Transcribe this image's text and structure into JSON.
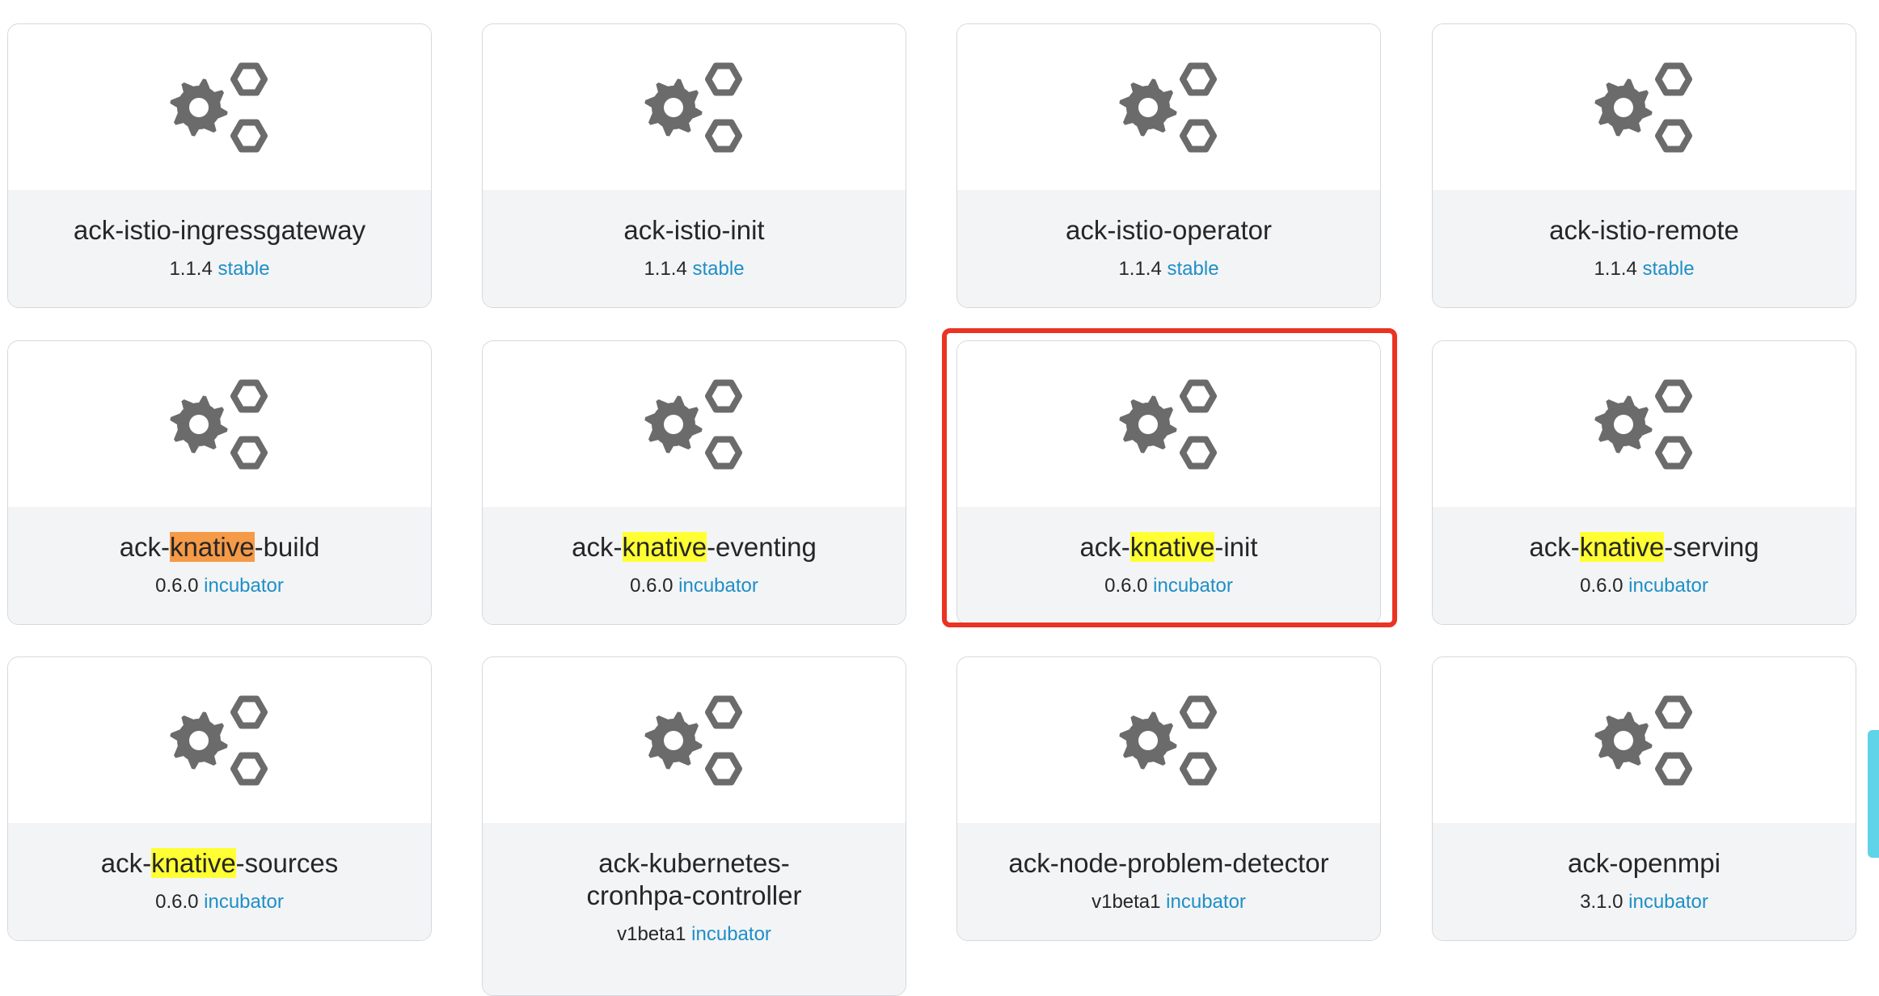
{
  "colors": {
    "highlight": "#ffff33",
    "highlight_active": "#f59a47",
    "channel_link": "#1e8fc6",
    "selection_border": "#ea3323",
    "icon_gray": "#6b6b6b"
  },
  "charts": [
    {
      "icon": "gears-icon",
      "name_prefix": "ack-istio-ingressgateway",
      "name_highlight": "",
      "name_suffix": "",
      "version": "1.1.4",
      "channel": "stable"
    },
    {
      "icon": "gears-icon",
      "name_prefix": "ack-istio-init",
      "name_highlight": "",
      "name_suffix": "",
      "version": "1.1.4",
      "channel": "stable"
    },
    {
      "icon": "gears-icon",
      "name_prefix": "ack-istio-operator",
      "name_highlight": "",
      "name_suffix": "",
      "version": "1.1.4",
      "channel": "stable"
    },
    {
      "icon": "gears-icon",
      "name_prefix": "ack-istio-remote",
      "name_highlight": "",
      "name_suffix": "",
      "version": "1.1.4",
      "channel": "stable"
    },
    {
      "icon": "gears-icon",
      "name_prefix": "ack-",
      "name_highlight": "knative",
      "name_suffix": "-build",
      "version": "0.6.0",
      "channel": "incubator",
      "active_match": true
    },
    {
      "icon": "gears-icon",
      "name_prefix": "ack-",
      "name_highlight": "knative",
      "name_suffix": "-eventing",
      "version": "0.6.0",
      "channel": "incubator"
    },
    {
      "icon": "gears-icon",
      "name_prefix": "ack-",
      "name_highlight": "knative",
      "name_suffix": "-init",
      "version": "0.6.0",
      "channel": "incubator",
      "selected": true
    },
    {
      "icon": "gears-icon",
      "name_prefix": "ack-",
      "name_highlight": "knative",
      "name_suffix": "-serving",
      "version": "0.6.0",
      "channel": "incubator"
    },
    {
      "icon": "gears-icon",
      "name_prefix": "ack-",
      "name_highlight": "knative",
      "name_suffix": "-sources",
      "version": "0.6.0",
      "channel": "incubator"
    },
    {
      "icon": "gears-icon",
      "name_prefix": "ack-kubernetes-cronhpa-controller",
      "name_highlight": "",
      "name_suffix": "",
      "version": "v1beta1",
      "channel": "incubator"
    },
    {
      "icon": "gears-icon",
      "name_prefix": "ack-node-problem-detector",
      "name_highlight": "",
      "name_suffix": "",
      "version": "v1beta1",
      "channel": "incubator"
    },
    {
      "icon": "gears-icon",
      "name_prefix": "ack-openmpi",
      "name_highlight": "",
      "name_suffix": "",
      "version": "3.1.0",
      "channel": "incubator"
    }
  ]
}
